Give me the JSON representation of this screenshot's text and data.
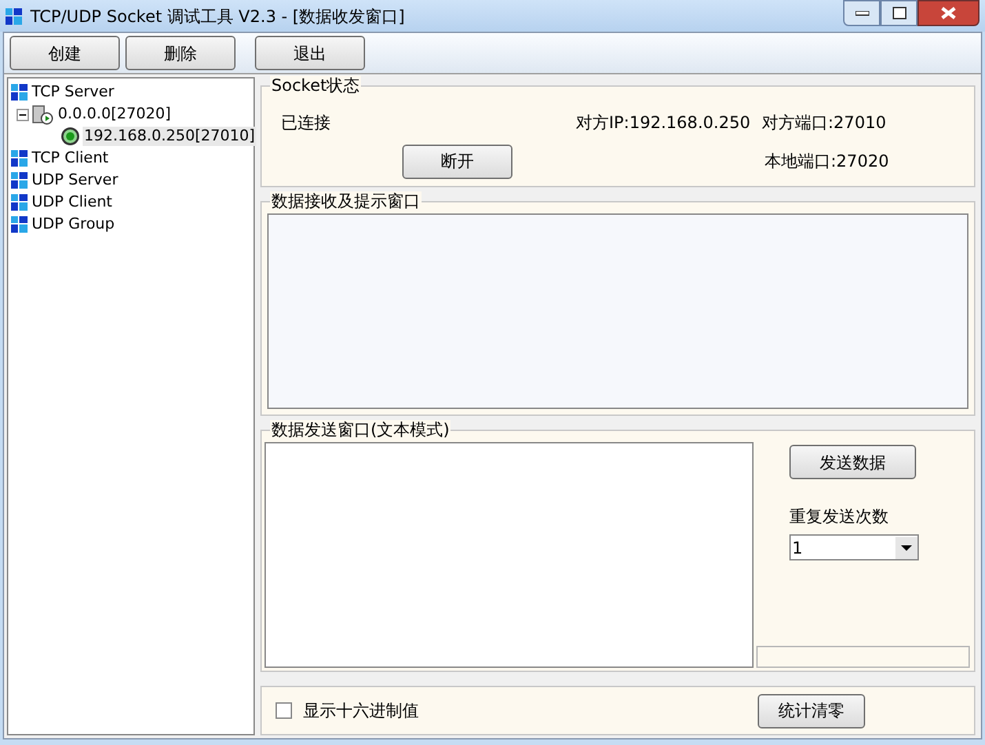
{
  "window": {
    "title": "TCP/UDP Socket 调试工具 V2.3 - [数据收发窗口]"
  },
  "toolbar": [
    "创建",
    "删除",
    "退出"
  ],
  "tree": [
    {
      "label": "TCP Server",
      "kind": "category",
      "selected": false,
      "children": [
        {
          "label": "0.0.0.0[27020]",
          "kind": "server",
          "selected": false,
          "expanded": true,
          "children": [
            {
              "label": "192.168.0.250[27010]",
              "kind": "connection",
              "selected": true
            }
          ]
        }
      ]
    },
    {
      "label": "TCP Client",
      "kind": "category",
      "selected": false
    },
    {
      "label": "UDP Server",
      "kind": "category",
      "selected": false
    },
    {
      "label": "UDP Client",
      "kind": "category",
      "selected": false
    },
    {
      "label": "UDP Group",
      "kind": "category",
      "selected": false
    }
  ],
  "socket_status": {
    "title": "Socket状态",
    "status": "已连接",
    "remote_ip": "对方IP:192.168.0.250",
    "remote_port": "对方端口:27010",
    "local_port": "本地端口:27020",
    "disconnect_button": "断开"
  },
  "receive": {
    "title": "数据接收及提示窗口"
  },
  "send": {
    "title": "数据发送窗口(文本模式)",
    "send_button": "发送数据",
    "repeat_label": "重复发送次数",
    "repeat_value": "1"
  },
  "bottom": {
    "hex_checkbox": {
      "label": "显示十六进制值",
      "checked": false
    },
    "reset_button": "统计清零"
  }
}
